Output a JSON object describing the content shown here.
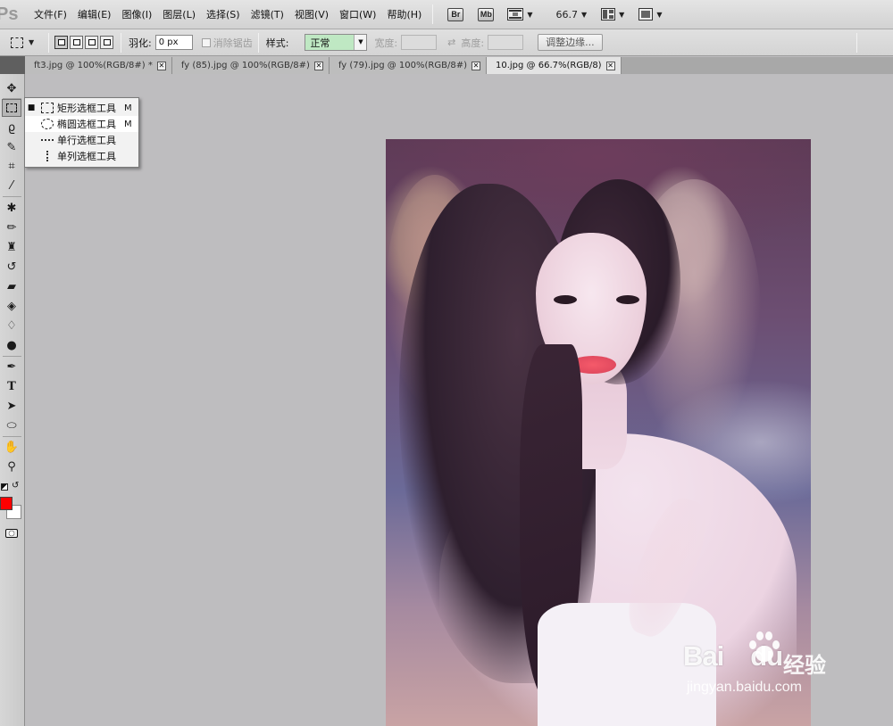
{
  "app": {
    "logo": "Ps"
  },
  "menu": {
    "items": [
      "文件(F)",
      "编辑(E)",
      "图像(I)",
      "图层(L)",
      "选择(S)",
      "滤镜(T)",
      "视图(V)",
      "窗口(W)",
      "帮助(H)"
    ],
    "bridge_label": "Br",
    "minibridge_label": "Mb",
    "zoom_value": "66.7"
  },
  "options": {
    "feather_label": "羽化:",
    "feather_value": "0 px",
    "antialias_label": "消除锯齿",
    "style_label": "样式:",
    "style_value": "正常",
    "width_label": "宽度:",
    "height_label": "高度:",
    "refine_edge_label": "调整边缘..."
  },
  "tabs": [
    {
      "label": "ft3.jpg @ 100%(RGB/8#) *",
      "active": false
    },
    {
      "label": "fy (85).jpg @ 100%(RGB/8#)",
      "active": false
    },
    {
      "label": "fy (79).jpg @ 100%(RGB/8#)",
      "active": false
    },
    {
      "label": "10.jpg @ 66.7%(RGB/8)",
      "active": true
    }
  ],
  "flyout": {
    "items": [
      {
        "label": "矩形选框工具",
        "shortcut": "M",
        "selected": true
      },
      {
        "label": "椭圆选框工具",
        "shortcut": "M",
        "selected": false
      },
      {
        "label": "单行选框工具",
        "shortcut": "",
        "selected": false
      },
      {
        "label": "单列选框工具",
        "shortcut": "",
        "selected": false
      }
    ]
  },
  "colors": {
    "foreground": "#ff0000",
    "background": "#ffffff",
    "canvas_bg": "#bebdbf"
  },
  "watermark": {
    "brand": "Bai",
    "brand_tail": "du",
    "cn": "经验",
    "url": "jingyan.baidu.com"
  },
  "toolbox_icons": [
    "move-icon",
    "marquee-icon",
    "lasso-icon",
    "quick-select-icon",
    "crop-icon",
    "eyedropper-icon",
    "healing-brush-icon",
    "brush-icon",
    "clone-stamp-icon",
    "history-brush-icon",
    "eraser-icon",
    "paint-bucket-icon",
    "blur-icon",
    "dodge-icon",
    "pen-icon",
    "type-icon",
    "path-select-icon",
    "ellipse-shape-icon",
    "hand-icon",
    "zoom-icon",
    "quick-mask-icon"
  ]
}
